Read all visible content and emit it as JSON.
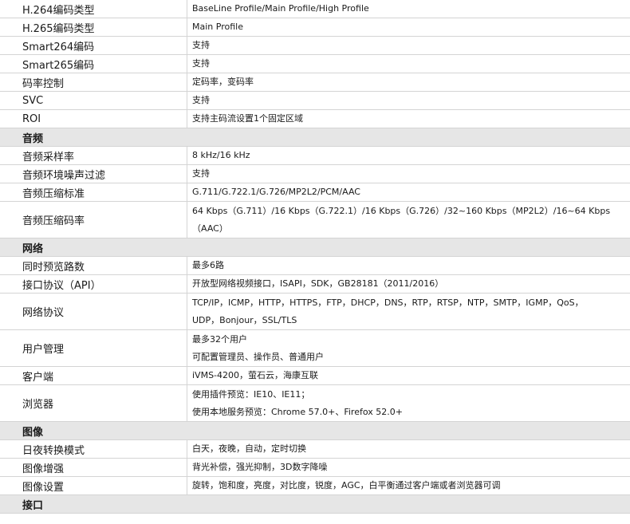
{
  "rows": [
    {
      "type": "spec",
      "label": "H.264编码类型",
      "value": [
        "BaseLine Profile/Main Profile/High Profile"
      ]
    },
    {
      "type": "spec",
      "label": "H.265编码类型",
      "value": [
        "Main Profile"
      ]
    },
    {
      "type": "spec",
      "label": "Smart264编码",
      "value": [
        "支持"
      ]
    },
    {
      "type": "spec",
      "label": "Smart265编码",
      "value": [
        "支持"
      ]
    },
    {
      "type": "spec",
      "label": "码率控制",
      "value": [
        "定码率，变码率"
      ]
    },
    {
      "type": "spec",
      "label": "SVC",
      "value": [
        "支持"
      ]
    },
    {
      "type": "spec",
      "label": "ROI",
      "value": [
        "支持主码流设置1个固定区域"
      ]
    },
    {
      "type": "section",
      "label": "音频"
    },
    {
      "type": "spec",
      "label": "音频采样率",
      "value": [
        "8 kHz/16 kHz"
      ]
    },
    {
      "type": "spec",
      "label": "音频环境噪声过滤",
      "value": [
        "支持"
      ]
    },
    {
      "type": "spec",
      "label": "音频压缩标准",
      "value": [
        "G.711/G.722.1/G.726/MP2L2/PCM/AAC"
      ]
    },
    {
      "type": "spec",
      "label": "音频压缩码率",
      "value": [
        "64 Kbps（G.711）/16 Kbps（G.722.1）/16 Kbps（G.726）/32~160 Kbps（MP2L2）/16~64 Kbps",
        "（AAC）"
      ]
    },
    {
      "type": "section",
      "label": "网络"
    },
    {
      "type": "spec",
      "label": "同时预览路数",
      "value": [
        "最多6路"
      ]
    },
    {
      "type": "spec",
      "label": "接口协议（API）",
      "value": [
        "开放型网络视频接口，ISAPI，SDK，GB28181（2011/2016）"
      ]
    },
    {
      "type": "spec",
      "label": "网络协议",
      "value": [
        "TCP/IP，ICMP，HTTP，HTTPS，FTP，DHCP，DNS，RTP，RTSP，NTP，SMTP，IGMP，QoS，",
        "UDP，Bonjour，SSL/TLS"
      ]
    },
    {
      "type": "spec",
      "label": "用户管理",
      "value": [
        "最多32个用户",
        "可配置管理员、操作员、普通用户"
      ]
    },
    {
      "type": "spec",
      "label": "客户端",
      "value": [
        "iVMS-4200，萤石云，海康互联"
      ]
    },
    {
      "type": "spec",
      "label": "浏览器",
      "value": [
        "使用插件预览：IE10、IE11；",
        "使用本地服务预览：Chrome 57.0+、Firefox 52.0+"
      ]
    },
    {
      "type": "section",
      "label": "图像"
    },
    {
      "type": "spec",
      "label": "日夜转换模式",
      "value": [
        "白天，夜晚，自动，定时切换"
      ]
    },
    {
      "type": "spec",
      "label": "图像增强",
      "value": [
        "背光补偿，强光抑制，3D数字降噪"
      ]
    },
    {
      "type": "spec",
      "label": "图像设置",
      "value": [
        "旋转，饱和度，亮度，对比度，锐度，AGC，白平衡通过客户端或者浏览器可调"
      ]
    },
    {
      "type": "section",
      "label": "接口"
    }
  ]
}
